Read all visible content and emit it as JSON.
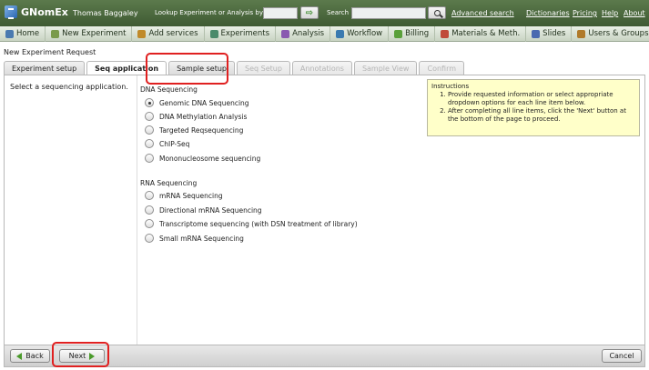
{
  "app": {
    "logo_text": "GNomEx",
    "username": "Thomas Baggaley",
    "lookup_label": "Lookup Experiment or Analysis by #",
    "search_label": "Search",
    "links": [
      "Advanced search",
      "Dictionaries",
      "Pricing",
      "Help",
      "About"
    ]
  },
  "nav": [
    {
      "label": "Home",
      "icon": "home-icon",
      "color": "#4a7ab0"
    },
    {
      "label": "New Experiment",
      "icon": "flask-icon",
      "color": "#7a9a4a"
    },
    {
      "label": "Add services",
      "icon": "plus-icon",
      "color": "#c08a2a"
    },
    {
      "label": "Experiments",
      "icon": "flask-icon",
      "color": "#4a8a6a"
    },
    {
      "label": "Analysis",
      "icon": "chart-icon",
      "color": "#8a5ab0"
    },
    {
      "label": "Workflow",
      "icon": "workflow-icon",
      "color": "#3a7ab0"
    },
    {
      "label": "Billing",
      "icon": "billing-icon",
      "color": "#5aa03a"
    },
    {
      "label": "Materials & Meth.",
      "icon": "materials-icon",
      "color": "#c04a3a"
    },
    {
      "label": "Slides",
      "icon": "slides-icon",
      "color": "#4a6ab0"
    },
    {
      "label": "Users & Groups",
      "icon": "users-icon",
      "color": "#b07a2a"
    }
  ],
  "panel_title": "New Experiment Request",
  "tabs": [
    {
      "label": "Experiment setup",
      "state": "normal"
    },
    {
      "label": "Seq application",
      "state": "active"
    },
    {
      "label": "Sample setup",
      "state": "normal"
    },
    {
      "label": "Seq Setup",
      "state": "disabled"
    },
    {
      "label": "Annotations",
      "state": "disabled"
    },
    {
      "label": "Sample View",
      "state": "disabled"
    },
    {
      "label": "Confirm",
      "state": "disabled"
    }
  ],
  "left_note": "Select a sequencing application.",
  "dna": {
    "title": "DNA Sequencing",
    "options": [
      "Genomic DNA Sequencing",
      "DNA Methylation Analysis",
      "Targeted Reqsequencing",
      "ChIP-Seq",
      "Mononucleosome sequencing"
    ],
    "selected_index": 0
  },
  "rna": {
    "title": "RNA Sequencing",
    "options": [
      "mRNA Sequencing",
      "Directional mRNA Sequencing",
      "Transcriptome sequencing (with DSN treatment of library)",
      "Small mRNA Sequencing"
    ]
  },
  "instructions": {
    "title": "Instructions",
    "items": [
      "Provide requested information or select appropriate dropdown options for each line item below.",
      "After completing all line items, click the 'Next' button at the bottom of the page to proceed."
    ]
  },
  "buttons": {
    "back": "Back",
    "next": "Next",
    "cancel": "Cancel"
  },
  "colors": {
    "highlight": "#e02020",
    "topbar": "#4f6b40",
    "instructions_bg": "#ffffc9"
  }
}
